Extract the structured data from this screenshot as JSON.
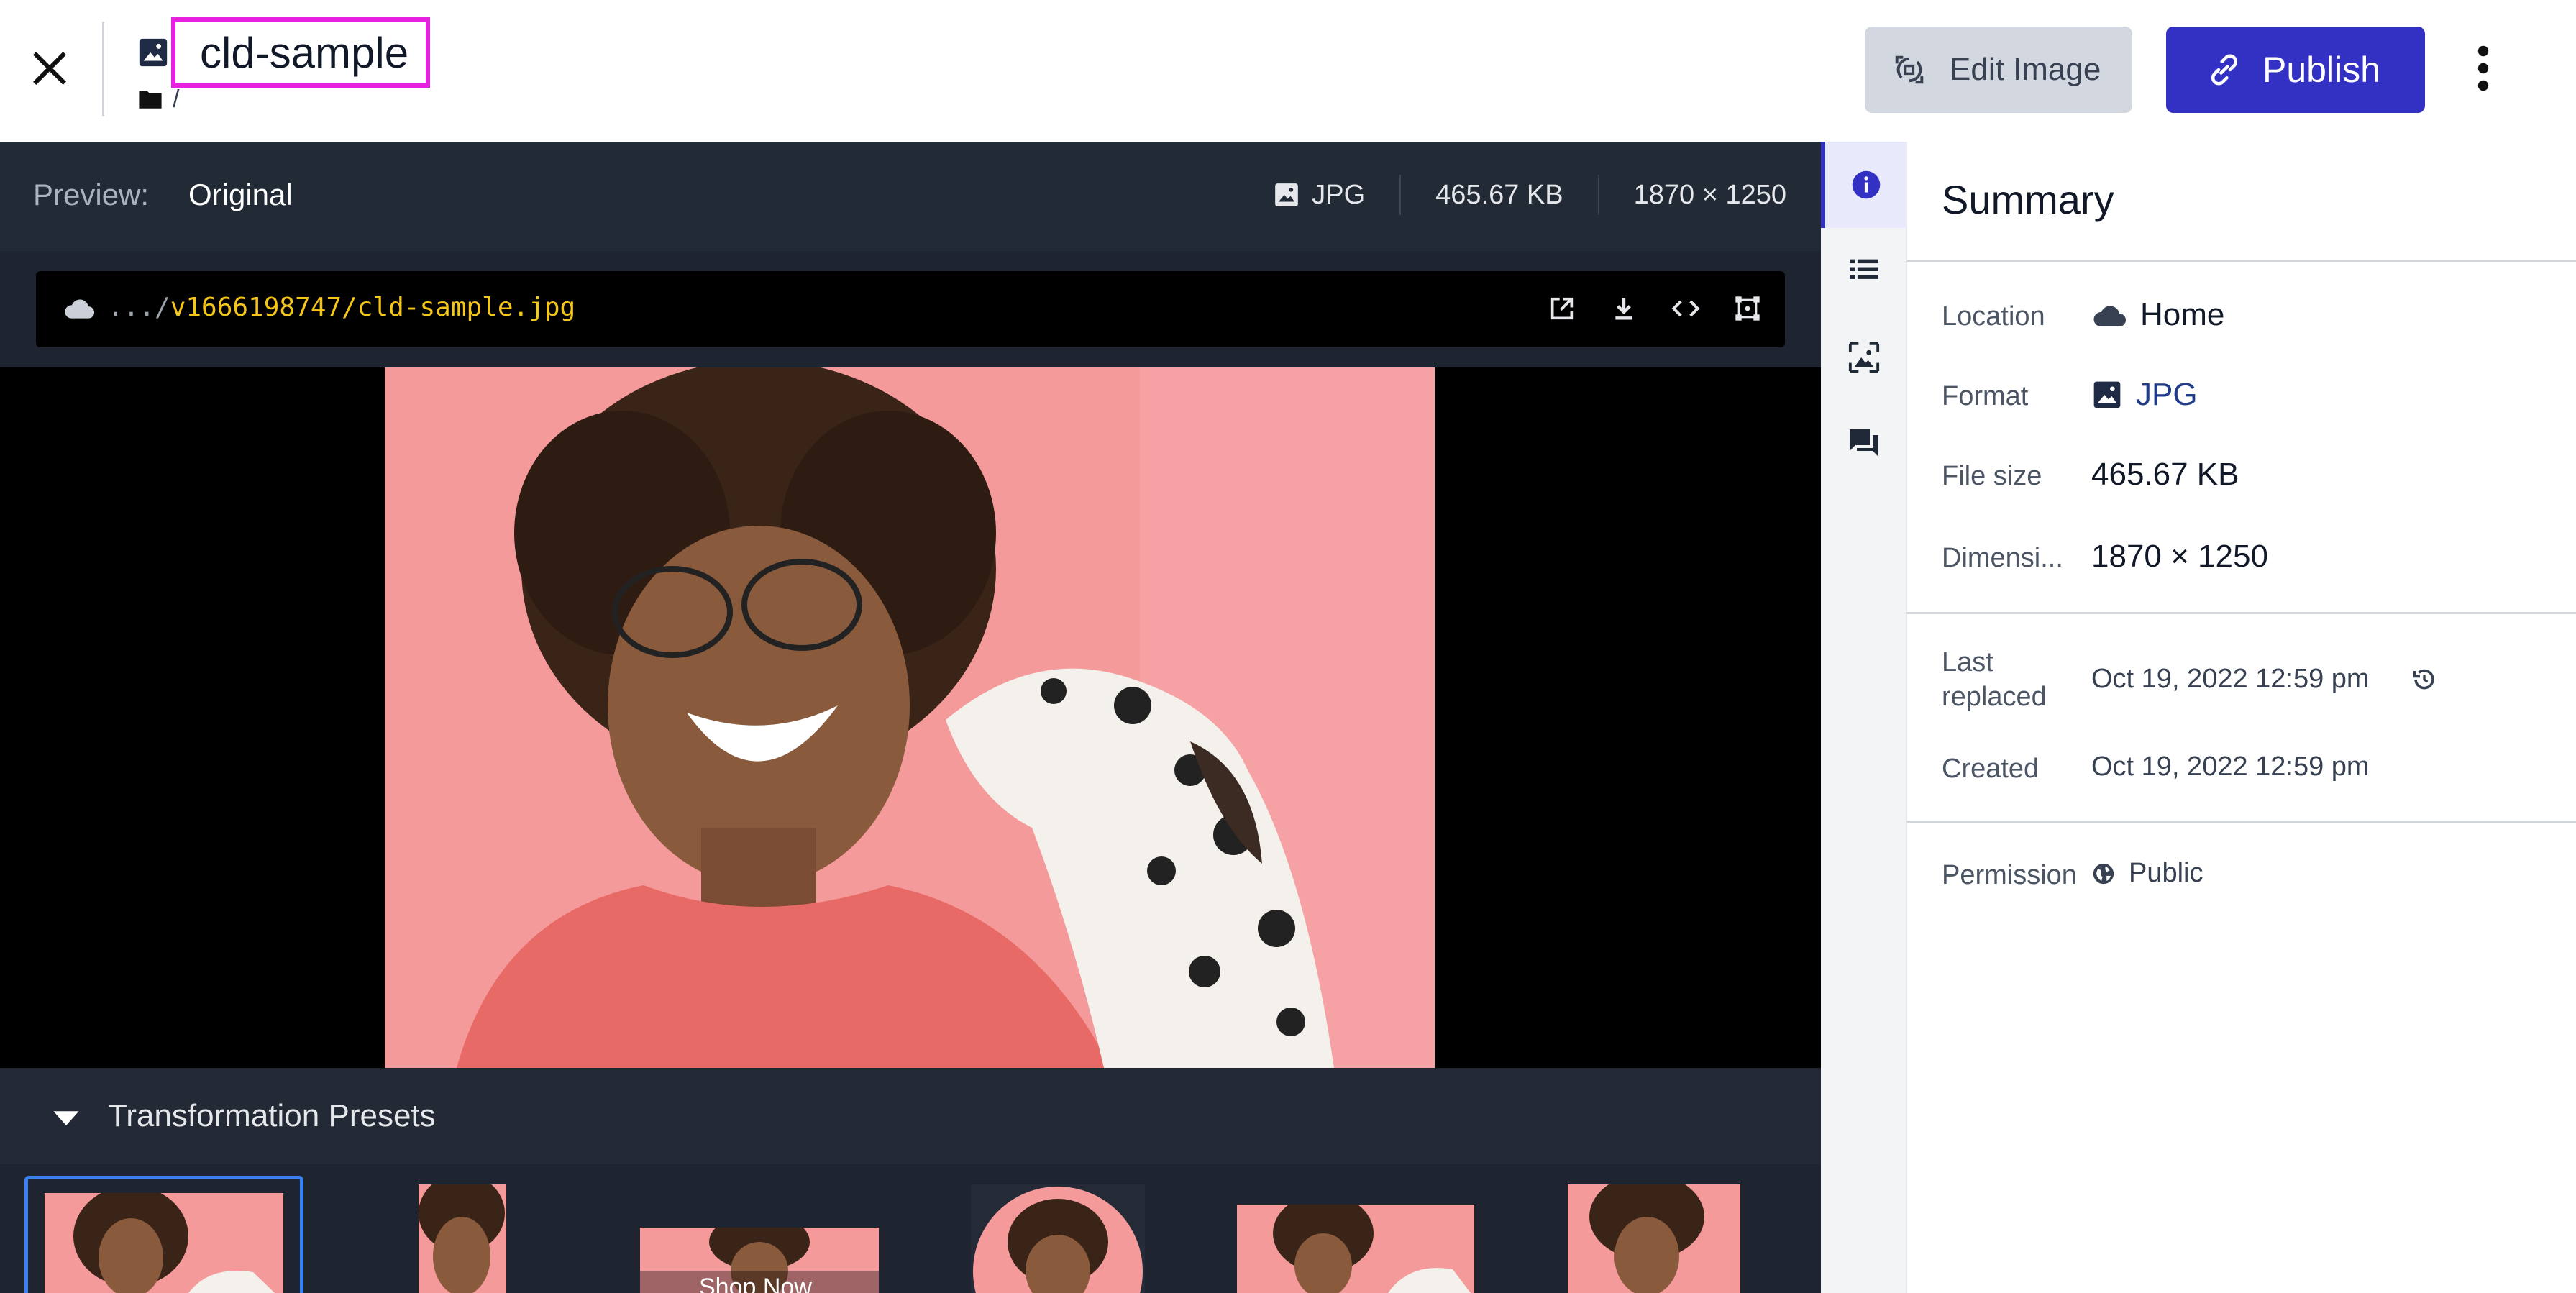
{
  "header": {
    "asset_name": "cld-sample",
    "breadcrumb": "/",
    "edit_button": "Edit Image",
    "publish_button": "Publish"
  },
  "preview": {
    "label": "Preview:",
    "value": "Original",
    "format": "JPG",
    "size": "465.67 KB",
    "dimensions": "1870 × 1250",
    "url_prefix": ".../",
    "url_path": "v1666198747/cld-sample.jpg",
    "photo_alt": "Woman laughing with a Dalmatian dog"
  },
  "presets": {
    "title": "Transformation Presets",
    "thumb_overlay_text": "Shop Now"
  },
  "summary": {
    "title": "Summary",
    "location_label": "Location",
    "location_value": "Home",
    "format_label": "Format",
    "format_value": "JPG",
    "filesize_label": "File size",
    "filesize_value": "465.67 KB",
    "dimensions_label": "Dimensi...",
    "dimensions_value": "1870 × 1250",
    "last_replaced_label_1": "Last",
    "last_replaced_label_2": "replaced",
    "last_replaced_value": "Oct 19, 2022 12:59 pm",
    "created_label": "Created",
    "created_value": "Oct 19, 2022 12:59 pm",
    "permission_label": "Permission",
    "permission_value": "Public"
  },
  "colors": {
    "accent": "#3330c4",
    "highlight_border": "#e621e0",
    "url_path": "#f5c518",
    "preview_bg": "#1e2430",
    "photo_bg": "#f49a9b"
  },
  "icons": [
    "close-icon",
    "image-icon",
    "folder-icon",
    "edit-image-icon",
    "link-icon",
    "kebab-icon",
    "cloud-icon",
    "open-external-icon",
    "download-icon",
    "code-icon",
    "crop-icon",
    "info-icon",
    "metadata-icon",
    "related-icon",
    "comments-icon",
    "history-icon",
    "globe-icon",
    "triangle-down-icon"
  ]
}
